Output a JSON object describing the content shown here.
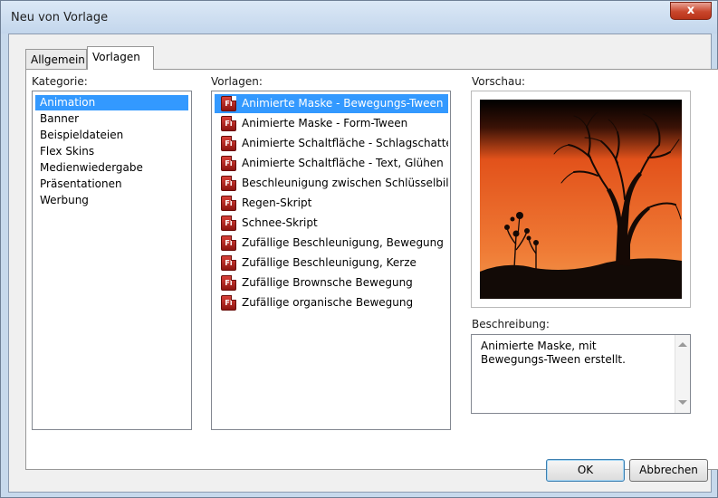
{
  "window": {
    "title": "Neu von Vorlage",
    "close_label": "x"
  },
  "tabs": [
    {
      "label": "Allgemein",
      "active": false
    },
    {
      "label": "Vorlagen",
      "active": true
    }
  ],
  "kategorie": {
    "label": "Kategorie:",
    "items": [
      "Animation",
      "Banner",
      "Beispieldateien",
      "Flex Skins",
      "Medienwiedergabe",
      "Präsentationen",
      "Werbung"
    ],
    "selected": "Animation"
  },
  "vorlagen": {
    "label": "Vorlagen:",
    "icon_text": "Fl",
    "items": [
      "Animierte Maske - Bewegungs-Tween",
      "Animierte Maske - Form-Tween",
      "Animierte Schaltfläche - Schlagschatten",
      "Animierte Schaltfläche - Text, Glühen",
      "Beschleunigung zwischen Schlüsselbil...",
      "Regen-Skript",
      "Schnee-Skript",
      "Zufällige Beschleunigung, Bewegung",
      "Zufällige Beschleunigung, Kerze",
      "Zufällige Brownsche Bewegung",
      "Zufällige organische Bewegung"
    ],
    "selected": "Animierte Maske - Bewegungs-Tween"
  },
  "vorschau": {
    "label": "Vorschau:"
  },
  "beschreibung": {
    "label": "Beschreibung:",
    "text": "Animierte Maske, mit\nBewegungs-Tween erstellt."
  },
  "buttons": {
    "ok": "OK",
    "cancel": "Abbrechen"
  },
  "colors": {
    "selection": "#3399ff",
    "preview_sky_top": "#e2521b",
    "preview_sky_bottom": "#f39a4d"
  }
}
